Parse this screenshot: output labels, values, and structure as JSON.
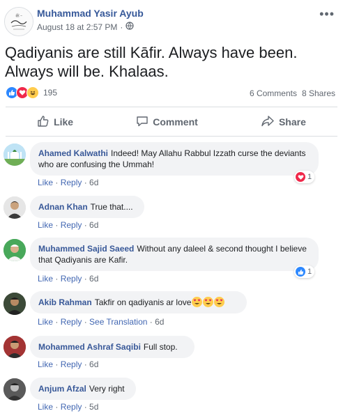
{
  "post": {
    "author": "Muhammad Yasir Ayub",
    "time": "August 18 at 2:57 PM",
    "text": "Qadiyanis are still Kāfir. Always have been. Always will be. Khalaas.",
    "reaction_count": "195",
    "comments_count": "6 Comments",
    "shares_count": "8 Shares",
    "colors": {
      "link": "#385898",
      "like_blue": "#2d88ff",
      "love_red": "#f0284a",
      "haha_yellow": "#ffcc4d"
    }
  },
  "actions": {
    "like": "Like",
    "comment": "Comment",
    "share": "Share"
  },
  "comment_links": {
    "like": "Like",
    "reply": "Reply",
    "see_translation": "See Translation"
  },
  "comments": [
    {
      "name": "Ahamed Kalwathi",
      "text": "Indeed! May Allahu Rabbul Izzath curse the deviants who are confusing the Ummah!",
      "time": "6d",
      "reaction_count": "1",
      "reaction": "love-icon"
    },
    {
      "name": "Adnan Khan",
      "text": "True that....",
      "time": "6d"
    },
    {
      "name": "Muhammed Sajid Saeed",
      "text": "Without any daleel & second thought I believe that Qadiyanis are Kafir.",
      "time": "6d",
      "reaction_count": "1",
      "reaction": "like-icon"
    },
    {
      "name": "Akib Rahman",
      "text": "Takfir on qadiyanis ar love",
      "time": "6d"
    },
    {
      "name": "Mohammed Ashraf Saqibi",
      "text": "Full stop.",
      "time": "6d"
    },
    {
      "name": "Anjum Afzal",
      "text": "Very right",
      "time": "5d"
    }
  ]
}
